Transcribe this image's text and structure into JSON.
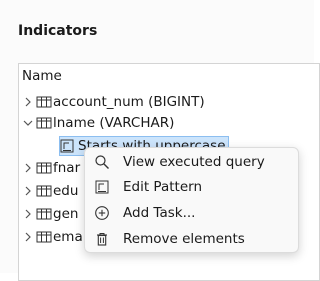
{
  "panel": {
    "title": "Indicators"
  },
  "tree": {
    "header": "Name",
    "rows": [
      {
        "label": "account_num (BIGINT)",
        "expanded": false
      },
      {
        "label": "lname (VARCHAR)",
        "expanded": true
      },
      {
        "label": "Starts with uppercase",
        "type": "pattern"
      },
      {
        "label": "fnar",
        "expanded": false
      },
      {
        "label": "edu",
        "expanded": false
      },
      {
        "label": "gen",
        "expanded": false
      },
      {
        "label": "ema",
        "expanded": false
      }
    ]
  },
  "context_menu": {
    "items": [
      {
        "label": "View executed query",
        "icon": "search-icon"
      },
      {
        "label": "Edit Pattern",
        "icon": "edit-pattern-icon"
      },
      {
        "label": "Add Task...",
        "icon": "add-circle-icon"
      },
      {
        "label": "Remove elements",
        "icon": "trash-icon"
      }
    ]
  },
  "colors": {
    "selection_bg": "#cce4fb",
    "selection_border": "#8cbef0",
    "menu_bg": "#f9f9f9"
  }
}
